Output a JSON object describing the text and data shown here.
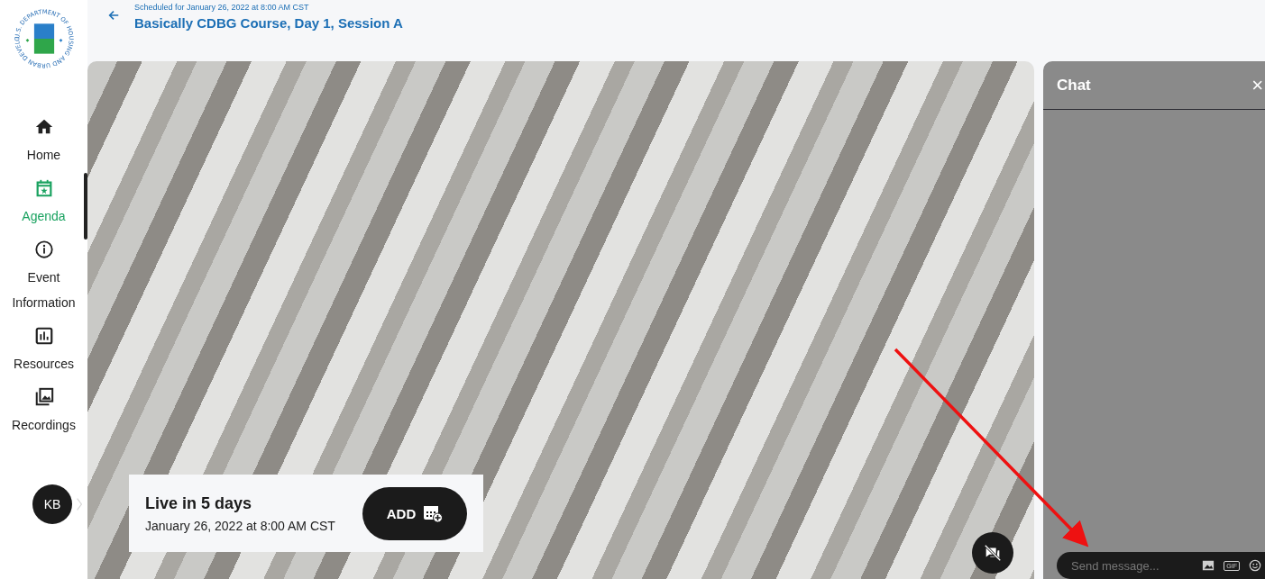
{
  "logo": {
    "text": "U.S. DEPARTMENT OF HOUSING AND URBAN DEVELOPMENT"
  },
  "sidebar": {
    "items": [
      {
        "label": "Home",
        "kind": "home",
        "selected": false
      },
      {
        "label": "Agenda",
        "kind": "calendar",
        "selected": true
      },
      {
        "label": "Event Information",
        "kind": "info",
        "selected": false
      },
      {
        "label": "Resources",
        "kind": "chart",
        "selected": false
      },
      {
        "label": "Recordings",
        "kind": "images",
        "selected": false
      }
    ],
    "avatar": "KB"
  },
  "header": {
    "schedule": "Scheduled for January 26, 2022 at 8:00 AM CST",
    "title": "Basically CDBG Course, Day 1, Session A"
  },
  "banner": {
    "status": "Live in 5 days",
    "date": "January 26, 2022 at 8:00 AM CST",
    "button": "ADD"
  },
  "chat": {
    "title": "Chat",
    "close": "×",
    "placeholder": "Send message...",
    "gif": "GIF"
  }
}
